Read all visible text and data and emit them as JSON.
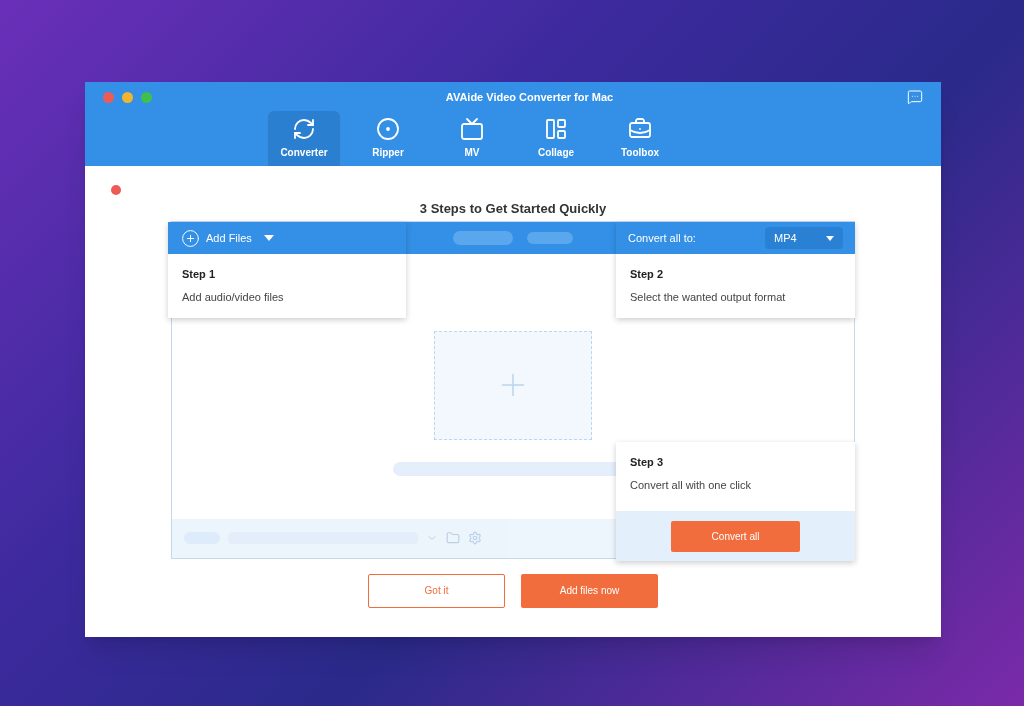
{
  "window": {
    "title": "AVAide Video Converter for Mac"
  },
  "tabs": [
    {
      "label": "Converter",
      "selected": true
    },
    {
      "label": "Ripper",
      "selected": false
    },
    {
      "label": "MV",
      "selected": false
    },
    {
      "label": "Collage",
      "selected": false
    },
    {
      "label": "Toolbox",
      "selected": false
    }
  ],
  "heading": "3 Steps to Get Started Quickly",
  "add_files_button": "Add Files",
  "convert_all_to": {
    "label": "Convert all to:",
    "format": "MP4"
  },
  "steps": [
    {
      "title": "Step 1",
      "text": "Add audio/video files"
    },
    {
      "title": "Step 2",
      "text": "Select the wanted output format"
    },
    {
      "title": "Step 3",
      "text": "Convert all with one click"
    }
  ],
  "convert_all_button": "Convert all",
  "buttons": [
    {
      "label": "Got it",
      "kind": "outline"
    },
    {
      "label": "Add files now",
      "kind": "filled"
    }
  ]
}
